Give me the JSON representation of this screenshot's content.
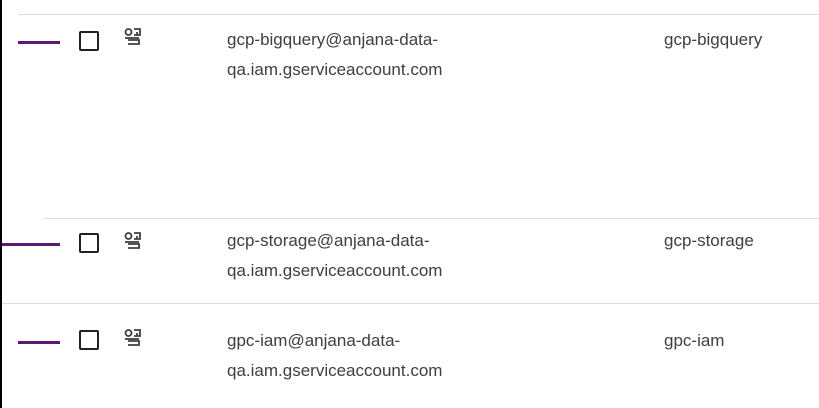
{
  "icons": {
    "row_marker": "purple-dash-marker",
    "checkbox": "checkbox-unchecked",
    "service_account": "service-account-icon"
  },
  "colors": {
    "marker": "#5b1a7a",
    "text": "#3c4043",
    "divider": "#dadce0"
  },
  "rows": [
    {
      "email_line1": "gcp-bigquery@anjana-data-",
      "email_line2": "qa.iam.gserviceaccount.com",
      "name": "gcp-bigquery"
    },
    {
      "email_line1": "gcp-storage@anjana-data-",
      "email_line2": "qa.iam.gserviceaccount.com",
      "name": "gcp-storage"
    },
    {
      "email_line1": "gpc-iam@anjana-data-",
      "email_line2": "qa.iam.gserviceaccount.com",
      "name": "gpc-iam"
    }
  ]
}
